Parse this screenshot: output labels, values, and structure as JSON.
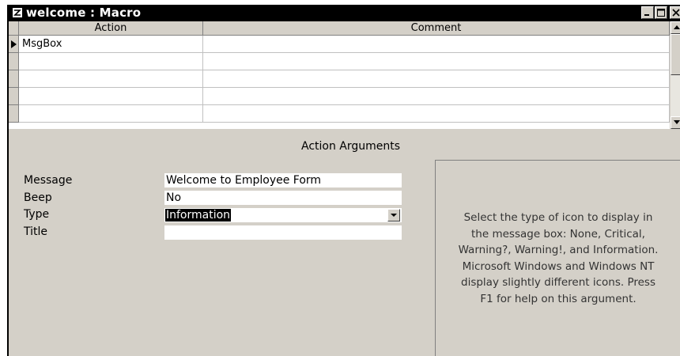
{
  "window": {
    "title": "welcome : Macro",
    "controls": [
      "minimize-icon",
      "maximize-icon",
      "close-icon"
    ]
  },
  "grid": {
    "columns": [
      "Action",
      "Comment"
    ],
    "rows": [
      {
        "action": "MsgBox",
        "comment": "",
        "current": true
      },
      {
        "action": "",
        "comment": ""
      },
      {
        "action": "",
        "comment": ""
      },
      {
        "action": "",
        "comment": ""
      },
      {
        "action": "",
        "comment": ""
      }
    ]
  },
  "arguments": {
    "section_title": "Action Arguments",
    "fields": [
      {
        "label": "Message",
        "value": "Welcome to Employee Form"
      },
      {
        "label": "Beep",
        "value": "No"
      },
      {
        "label": "Type",
        "value": "Information",
        "selected": true
      },
      {
        "label": "Title",
        "value": ""
      }
    ],
    "help_lines": [
      "Select the type of icon to display in",
      "the message box: None, Critical,",
      "Warning?, Warning!, and Information.",
      "Microsoft Windows and Windows NT",
      "display slightly different icons. Press",
      "F1 for help on this argument."
    ]
  }
}
